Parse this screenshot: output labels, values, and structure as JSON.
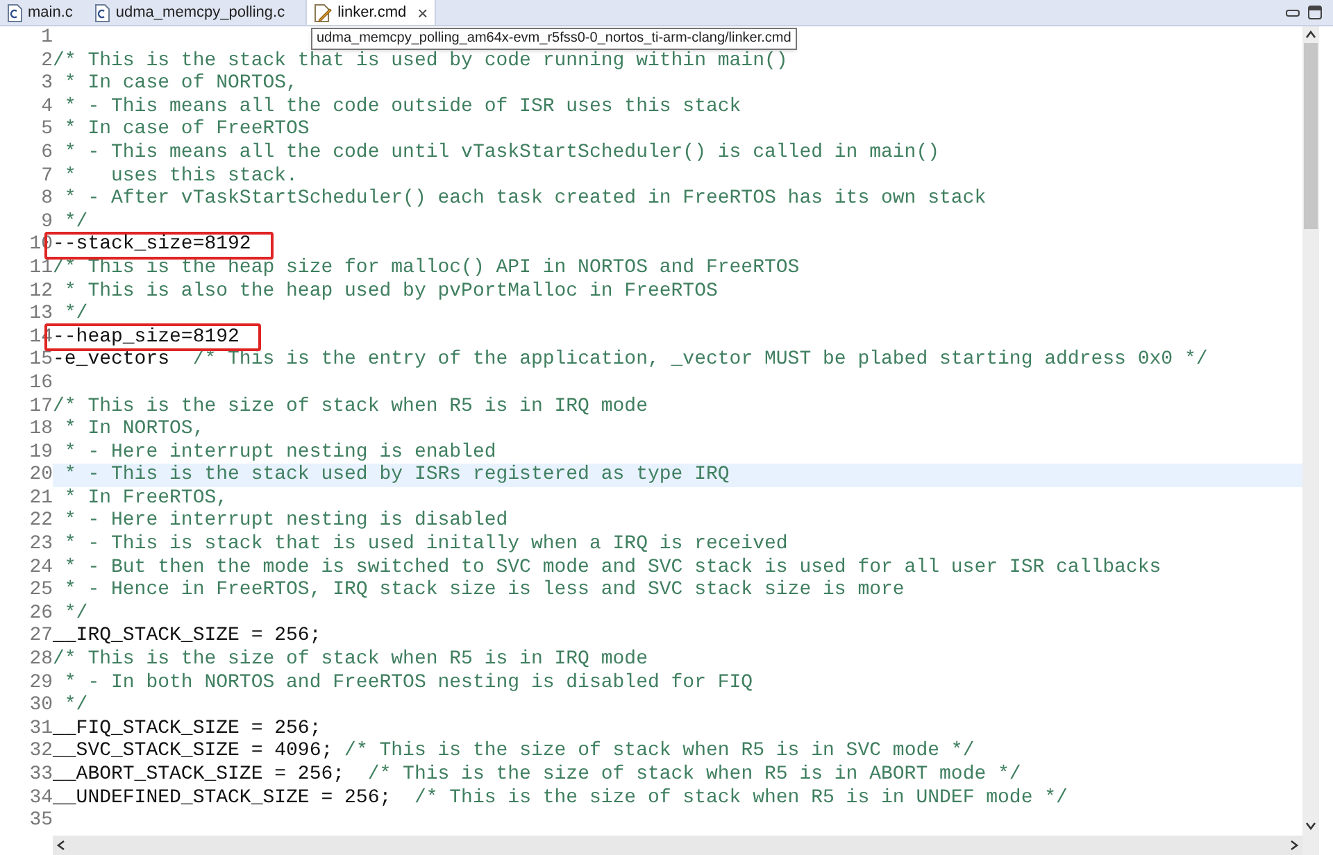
{
  "tabs": [
    {
      "label": "main.c",
      "kind": "source",
      "selected": false
    },
    {
      "label": "udma_memcpy_polling.c",
      "kind": "source",
      "selected": false
    },
    {
      "label": "linker.cmd",
      "kind": "command",
      "selected": true,
      "close": "×"
    }
  ],
  "tooltip": "udma_memcpy_polling_am64x-evm_r5fss0-0_nortos_ti-arm-clang/linker.cmd",
  "lines": [
    {
      "number": "1",
      "current": false,
      "boxed": false
    },
    {
      "number": "2",
      "current": false,
      "boxed": false,
      "segments": [
        {
          "kind": "comment",
          "text": "/* This is the stack that is used by code running within main()"
        }
      ]
    },
    {
      "number": "3",
      "current": false,
      "boxed": false,
      "segments": [
        {
          "kind": "comment",
          "text": " * In case of NORTOS,"
        }
      ]
    },
    {
      "number": "4",
      "current": false,
      "boxed": false,
      "segments": [
        {
          "kind": "comment",
          "text": " * - This means all the code outside of ISR uses this stack"
        }
      ]
    },
    {
      "number": "5",
      "current": false,
      "boxed": false,
      "segments": [
        {
          "kind": "comment",
          "text": " * In case of FreeRTOS"
        }
      ]
    },
    {
      "number": "6",
      "current": false,
      "boxed": false,
      "segments": [
        {
          "kind": "comment",
          "text": " * - This means all the code until vTaskStartScheduler() is called in main()"
        }
      ]
    },
    {
      "number": "7",
      "current": false,
      "boxed": false,
      "segments": [
        {
          "kind": "comment",
          "text": " *   uses this stack."
        }
      ]
    },
    {
      "number": "8",
      "current": false,
      "boxed": false,
      "segments": [
        {
          "kind": "comment",
          "text": " * - After vTaskStartScheduler() each task created in FreeRTOS has its own stack"
        }
      ]
    },
    {
      "number": "9",
      "current": false,
      "boxed": false,
      "segments": [
        {
          "kind": "comment",
          "text": " */"
        }
      ]
    },
    {
      "number": "10",
      "current": false,
      "boxed": true,
      "segments": [
        {
          "kind": "code",
          "text": "--stack_size=8192"
        }
      ]
    },
    {
      "number": "11",
      "current": false,
      "boxed": false,
      "segments": [
        {
          "kind": "comment",
          "text": "/* This is the heap size for malloc() API in NORTOS and FreeRTOS"
        }
      ]
    },
    {
      "number": "12",
      "current": false,
      "boxed": false,
      "segments": [
        {
          "kind": "comment",
          "text": " * This is also the heap used by pvPortMalloc in FreeRTOS"
        }
      ]
    },
    {
      "number": "13",
      "current": false,
      "boxed": false,
      "segments": [
        {
          "kind": "comment",
          "text": " */"
        }
      ]
    },
    {
      "number": "14",
      "current": false,
      "boxed": true,
      "segments": [
        {
          "kind": "code",
          "text": "--heap_size=8192"
        }
      ]
    },
    {
      "number": "15",
      "current": false,
      "boxed": false,
      "segments": [
        {
          "kind": "code",
          "text": "-e_vectors  "
        },
        {
          "kind": "comment",
          "text": "/* This is the entry of the application, _vector MUST be plabed starting address 0x0 */"
        }
      ]
    },
    {
      "number": "16",
      "current": false,
      "boxed": false
    },
    {
      "number": "17",
      "current": false,
      "boxed": false,
      "segments": [
        {
          "kind": "comment",
          "text": "/* This is the size of stack when R5 is in IRQ mode"
        }
      ]
    },
    {
      "number": "18",
      "current": false,
      "boxed": false,
      "segments": [
        {
          "kind": "comment",
          "text": " * In NORTOS,"
        }
      ]
    },
    {
      "number": "19",
      "current": false,
      "boxed": false,
      "segments": [
        {
          "kind": "comment",
          "text": " * - Here interrupt nesting is enabled"
        }
      ]
    },
    {
      "number": "20",
      "current": true,
      "boxed": false,
      "segments": [
        {
          "kind": "comment",
          "text": " * - This is the stack used by ISRs registered as type IRQ"
        }
      ]
    },
    {
      "number": "21",
      "current": false,
      "boxed": false,
      "segments": [
        {
          "kind": "comment",
          "text": " * In FreeRTOS,"
        }
      ]
    },
    {
      "number": "22",
      "current": false,
      "boxed": false,
      "segments": [
        {
          "kind": "comment",
          "text": " * - Here interrupt nesting is disabled"
        }
      ]
    },
    {
      "number": "23",
      "current": false,
      "boxed": false,
      "segments": [
        {
          "kind": "comment",
          "text": " * - This is stack that is used initally when a IRQ is received"
        }
      ]
    },
    {
      "number": "24",
      "current": false,
      "boxed": false,
      "segments": [
        {
          "kind": "comment",
          "text": " * - But then the mode is switched to SVC mode and SVC stack is used for all user ISR callbacks"
        }
      ]
    },
    {
      "number": "25",
      "current": false,
      "boxed": false,
      "segments": [
        {
          "kind": "comment",
          "text": " * - Hence in FreeRTOS, IRQ stack size is less and SVC stack size is more"
        }
      ]
    },
    {
      "number": "26",
      "current": false,
      "boxed": false,
      "segments": [
        {
          "kind": "comment",
          "text": " */"
        }
      ]
    },
    {
      "number": "27",
      "current": false,
      "boxed": false,
      "segments": [
        {
          "kind": "code",
          "text": "__IRQ_STACK_SIZE = 256;"
        }
      ]
    },
    {
      "number": "28",
      "current": false,
      "boxed": false,
      "segments": [
        {
          "kind": "comment",
          "text": "/* This is the size of stack when R5 is in IRQ mode"
        }
      ]
    },
    {
      "number": "29",
      "current": false,
      "boxed": false,
      "segments": [
        {
          "kind": "comment",
          "text": " * - In both NORTOS and FreeRTOS nesting is disabled for FIQ"
        }
      ]
    },
    {
      "number": "30",
      "current": false,
      "boxed": false,
      "segments": [
        {
          "kind": "comment",
          "text": " */"
        }
      ]
    },
    {
      "number": "31",
      "current": false,
      "boxed": false,
      "segments": [
        {
          "kind": "code",
          "text": "__FIQ_STACK_SIZE = 256;"
        }
      ]
    },
    {
      "number": "32",
      "current": false,
      "boxed": false,
      "segments": [
        {
          "kind": "code",
          "text": "__SVC_STACK_SIZE = 4096; "
        },
        {
          "kind": "comment",
          "text": "/* This is the size of stack when R5 is in SVC mode */"
        }
      ]
    },
    {
      "number": "33",
      "current": false,
      "boxed": false,
      "segments": [
        {
          "kind": "code",
          "text": "__ABORT_STACK_SIZE = 256;  "
        },
        {
          "kind": "comment",
          "text": "/* This is the size of stack when R5 is in ABORT mode */"
        }
      ]
    },
    {
      "number": "34",
      "current": false,
      "boxed": false,
      "segments": [
        {
          "kind": "code",
          "text": "__UNDEFINED_STACK_SIZE = 256;  "
        },
        {
          "kind": "comment",
          "text": "/* This is the size of stack when R5 is in UNDEF mode */"
        }
      ]
    },
    {
      "number": "35",
      "current": false,
      "boxed": false
    }
  ]
}
